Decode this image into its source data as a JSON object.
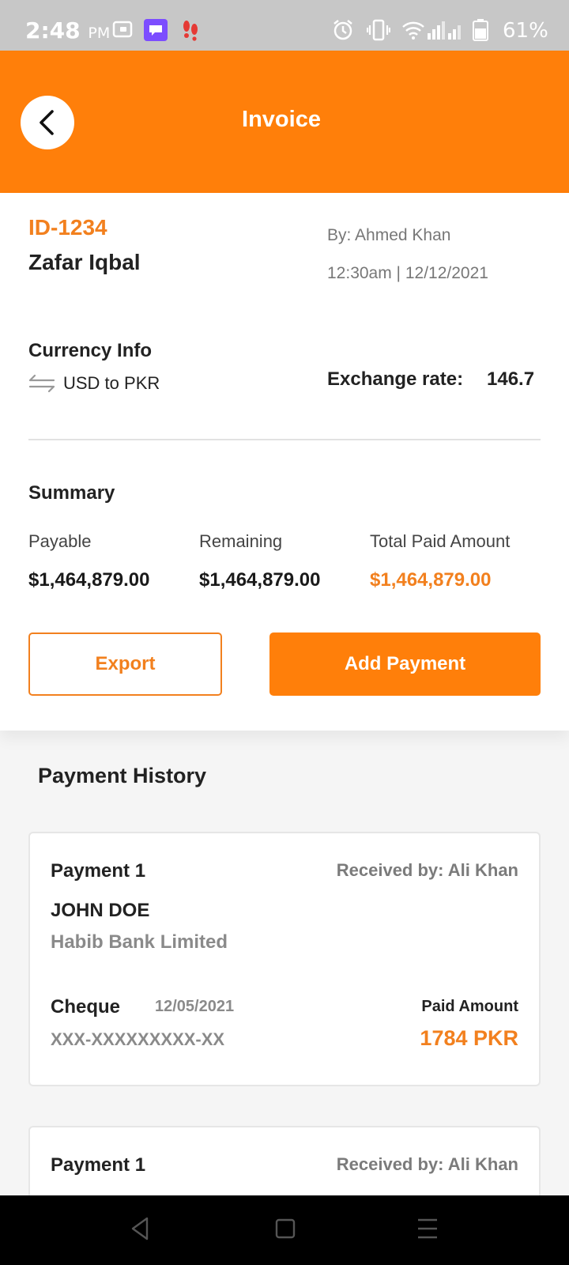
{
  "status_bar": {
    "time": "2:48",
    "ampm": "PM",
    "battery_text": "61%"
  },
  "header": {
    "title": "Invoice"
  },
  "invoice": {
    "id": "ID-1234",
    "customer": "Zafar Iqbal",
    "created_by": "By: Ahmed Khan",
    "created_at": "12:30am | 12/12/2021"
  },
  "currency": {
    "title": "Currency Info",
    "pair": "USD to PKR",
    "exchange_label": "Exchange rate:",
    "exchange_value": "146.7"
  },
  "summary": {
    "title": "Summary",
    "items": [
      {
        "label": "Payable",
        "value": "$1,464,879.00"
      },
      {
        "label": "Remaining",
        "value": "$1,464,879.00"
      },
      {
        "label": "Total Paid Amount",
        "value": "$1,464,879.00"
      }
    ]
  },
  "actions": {
    "export_label": "Export",
    "add_payment_label": "Add Payment"
  },
  "history": {
    "title": "Payment History",
    "payments": [
      {
        "title": "Payment 1",
        "received_by": "Received by: Ali Khan",
        "payer": "JOHN DOE",
        "bank": "Habib Bank Limited",
        "method": "Cheque",
        "date": "12/05/2021",
        "paid_label": "Paid Amount",
        "account": "XXX-XXXXXXXXX-XX",
        "amount": "1784 PKR"
      },
      {
        "title": "Payment 1",
        "received_by": "Received by: Ali Khan"
      }
    ]
  },
  "colors": {
    "accent": "#ff7f0a",
    "accent_text": "#f2801e",
    "status_bar": "#c7c7c7"
  }
}
